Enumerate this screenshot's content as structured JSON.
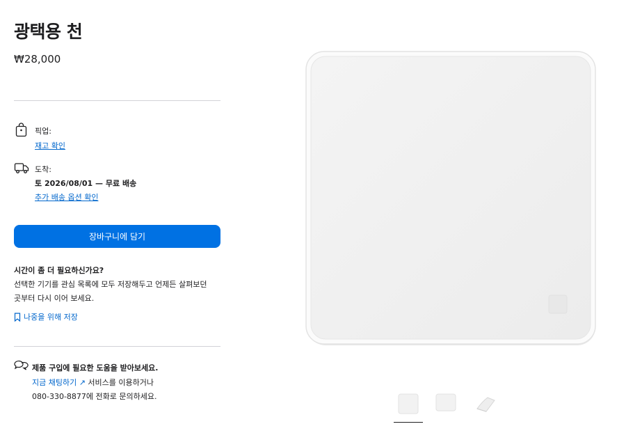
{
  "product": {
    "title": "광택용 천",
    "price": "₩28,000"
  },
  "pickup": {
    "label": "픽업:",
    "link": "재고 확인",
    "icon": "shopping-bag-icon"
  },
  "delivery": {
    "label": "도착:",
    "date": "토 2026/08/01 — 무료 배송",
    "link": "추가 배송 옵션 확인",
    "icon": "delivery-truck-icon"
  },
  "cart_button": "장바구니에 담기",
  "save_later": {
    "title": "시간이 좀 더 필요하신가요?",
    "line1": "선택한 기기를 관심 목록에 모두 저장해두고 언제든 살펴보던",
    "line2": "곳부터 다시 이어 보세요.",
    "link": "나중을 위해 저장",
    "icon": "bookmark-icon"
  },
  "help": {
    "title": "제품 구입에 필요한 도움을 받아보세요.",
    "chat_link": "지금 채팅하기 ↗",
    "line2_rest": " 서비스를 이용하거나",
    "line3": "080-330-8877에 전화로 문의하세요.",
    "icon": "chat-bubbles-icon"
  },
  "colors": {
    "accent": "#0071e3",
    "link": "#0066cc",
    "text": "#1d1d1f",
    "divider": "#d2d2d7"
  },
  "gallery": {
    "thumbnails": [
      "thumbnail-cloth-front",
      "thumbnail-cloth-flat",
      "thumbnail-cloth-folded"
    ],
    "selected_index": 0
  }
}
